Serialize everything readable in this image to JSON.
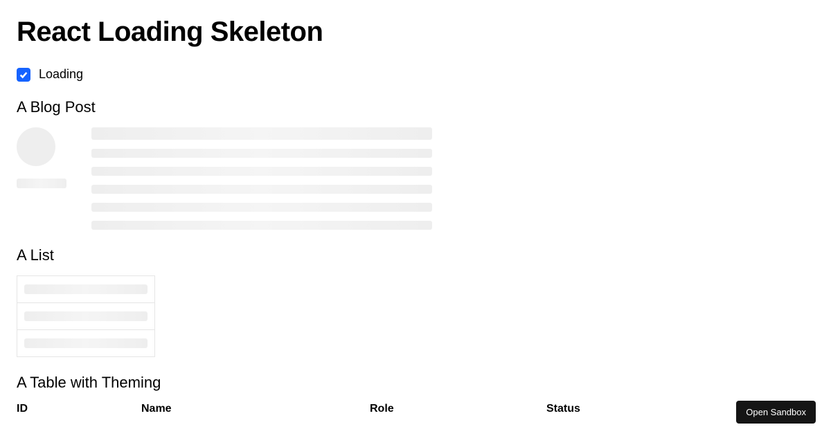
{
  "page_title": "React Loading Skeleton",
  "loading_checkbox": {
    "label": "Loading",
    "checked": true
  },
  "sections": {
    "blog_post": {
      "heading": "A Blog Post"
    },
    "list": {
      "heading": "A List"
    },
    "table": {
      "heading": "A Table with Theming",
      "columns": [
        "ID",
        "Name",
        "Role",
        "Status"
      ]
    }
  },
  "sandbox_button": {
    "label": "Open Sandbox"
  }
}
